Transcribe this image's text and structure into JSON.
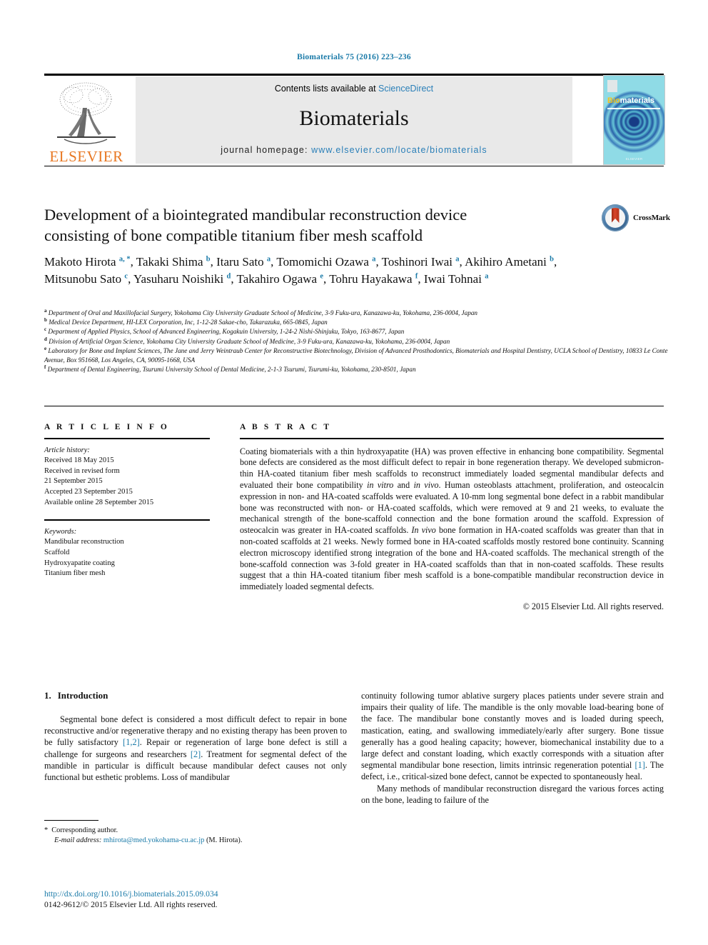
{
  "running_head": "Biomaterials 75 (2016) 223–236",
  "masthead": {
    "contents_prefix": "Contents lists available at ",
    "contents_link": "ScienceDirect",
    "journal_name": "Biomaterials",
    "homepage_prefix": "journal homepage: ",
    "homepage_link": "www.elsevier.com/locate/biomaterials",
    "publisher": "ELSEVIER",
    "cover": {
      "title_bio": "Bio",
      "title_rest": "materials",
      "footer": "ELSEVIER"
    }
  },
  "article": {
    "title_line1": "Development of a biointegrated mandibular reconstruction device",
    "title_line2": "consisting of bone compatible titanium fiber mesh scaffold",
    "crossmark_label": "CrossMark",
    "authors": [
      {
        "name": "Makoto Hirota",
        "marks": "a, *",
        "sep": ", "
      },
      {
        "name": "Takaki Shima",
        "marks": "b",
        "sep": ", "
      },
      {
        "name": "Itaru Sato",
        "marks": "a",
        "sep": ", "
      },
      {
        "name": "Tomomichi Ozawa",
        "marks": "a",
        "sep": ", "
      },
      {
        "name": "Toshinori Iwai",
        "marks": "a",
        "sep": ", "
      },
      {
        "name": "Akihiro Ametani",
        "marks": "b",
        "sep": ", "
      },
      {
        "name": "Mitsunobu Sato",
        "marks": "c",
        "sep": ", "
      },
      {
        "name": "Yasuharu Noishiki",
        "marks": "d",
        "sep": ", "
      },
      {
        "name": "Takahiro Ogawa",
        "marks": "e",
        "sep": ", "
      },
      {
        "name": "Tohru Hayakawa",
        "marks": "f",
        "sep": ", "
      },
      {
        "name": "Iwai Tohnai",
        "marks": "a",
        "sep": ""
      }
    ],
    "affiliations": [
      {
        "mark": "a",
        "text": "Department of Oral and Maxillofacial Surgery, Yokohama City University Graduate School of Medicine, 3-9 Fuku-ura, Kanazawa-ku, Yokohama, 236-0004, Japan"
      },
      {
        "mark": "b",
        "text": "Medical Device Department, HI-LEX Corporation, Inc, 1-12-28 Sakae-cho, Takarazuka, 665-0845, Japan"
      },
      {
        "mark": "c",
        "text": "Department of Applied Physics, School of Advanced Engineering, Kogakuin University, 1-24-2 Nishi-Shinjuku, Tokyo, 163-8677, Japan"
      },
      {
        "mark": "d",
        "text": "Division of Artificial Organ Science, Yokohama City University Graduate School of Medicine, 3-9 Fuku-ura, Kanazawa-ku, Yokohama, 236-0004, Japan"
      },
      {
        "mark": "e",
        "text": "Laboratory for Bone and Implant Sciences, The Jane and Jerry Weintraub Center for Reconstructive Biotechnology, Division of Advanced Prosthodontics, Biomaterials and Hospital Dentistry, UCLA School of Dentistry, 10833 Le Conte Avenue, Box 951668, Los Angeles, CA, 90095-1668, USA"
      },
      {
        "mark": "f",
        "text": "Department of Dental Engineering, Tsurumi University School of Dental Medicine, 2-1-3 Tsurumi, Tsurumi-ku, Yokohama, 230-8501, Japan"
      }
    ]
  },
  "article_info": {
    "heading": "A R T I C L E    I N F O",
    "history_label": "Article history:",
    "history": [
      "Received 18 May 2015",
      "Received in revised form",
      "21 September 2015",
      "Accepted 23 September 2015",
      "Available online 28 September 2015"
    ],
    "keywords_label": "Keywords:",
    "keywords": [
      "Mandibular reconstruction",
      "Scaffold",
      "Hydroxyapatite coating",
      "Titanium fiber mesh"
    ]
  },
  "abstract": {
    "heading": "A B S T R A C T",
    "text_part1": "Coating biomaterials with a thin hydroxyapatite (HA) was proven effective in enhancing bone compatibility. Segmental bone defects are considered as the most difficult defect to repair in bone regeneration therapy. We developed submicron-thin HA-coated titanium fiber mesh scaffolds to reconstruct immediately loaded segmental mandibular defects and evaluated their bone compatibility ",
    "italic1": "in vitro",
    "text_part2": " and ",
    "italic2": "in vivo",
    "text_part3": ". Human osteoblasts attachment, proliferation, and osteocalcin expression in non- and HA-coated scaffolds were evaluated. A 10-mm long segmental bone defect in a rabbit mandibular bone was reconstructed with non- or HA-coated scaffolds, which were removed at 9 and 21 weeks, to evaluate the mechanical strength of the bone-scaffold connection and the bone formation around the scaffold. Expression of osteocalcin was greater in HA-coated scaffolds. ",
    "italic3": "In vivo",
    "text_part4": " bone formation in HA-coated scaffolds was greater than that in non-coated scaffolds at 21 weeks. Newly formed bone in HA-coated scaffolds mostly restored bone continuity. Scanning electron microscopy identified strong integration of the bone and HA-coated scaffolds. The mechanical strength of the bone-scaffold connection was 3-fold greater in HA-coated scaffolds than that in non-coated scaffolds. These results suggest that a thin HA-coated titanium fiber mesh scaffold is a bone-compatible mandibular reconstruction device in immediately loaded segmental defects.",
    "copyright": "© 2015 Elsevier Ltd. All rights reserved."
  },
  "introduction": {
    "number": "1.",
    "title": "Introduction",
    "left_para_a": "Segmental bone defect is considered a most difficult defect to repair in bone reconstructive and/or regenerative therapy and no existing therapy has been proven to be fully satisfactory ",
    "left_ref_1": "[1,2]",
    "left_para_b": ". Repair or regeneration of large bone defect is still a challenge for surgeons and researchers ",
    "left_ref_2": "[2]",
    "left_para_c": ". Treatment for segmental defect of the mandible in particular is difficult because mandibular defect causes not only functional but esthetic problems. Loss of mandibular",
    "right_para_a": "continuity following tumor ablative surgery places patients under severe strain and impairs their quality of life. The mandible is the only movable load-bearing bone of the face. The mandibular bone constantly moves and is loaded during speech, mastication, eating, and swallowing immediately/early after surgery. Bone tissue generally has a good healing capacity; however, biomechanical instability due to a large defect and constant loading, which exactly corresponds with a situation after segmental mandibular bone resection, limits intrinsic regeneration potential ",
    "right_ref_1": "[1]",
    "right_para_b": ". The defect, i.e., critical-sized bone defect, cannot be expected to spontaneously heal.",
    "right_para_c": "Many methods of mandibular reconstruction disregard the various forces acting on the bone, leading to failure of the"
  },
  "footnote": {
    "star": "*",
    "corresponding": "Corresponding author.",
    "email_label": "E-mail address:",
    "email": "mhirota@med.yokohama-cu.ac.jp",
    "email_owner": "(M. Hirota)."
  },
  "footer": {
    "doi": "http://dx.doi.org/10.1016/j.biomaterials.2015.09.034",
    "issn_line": "0142-9612/© 2015 Elsevier Ltd. All rights reserved."
  }
}
